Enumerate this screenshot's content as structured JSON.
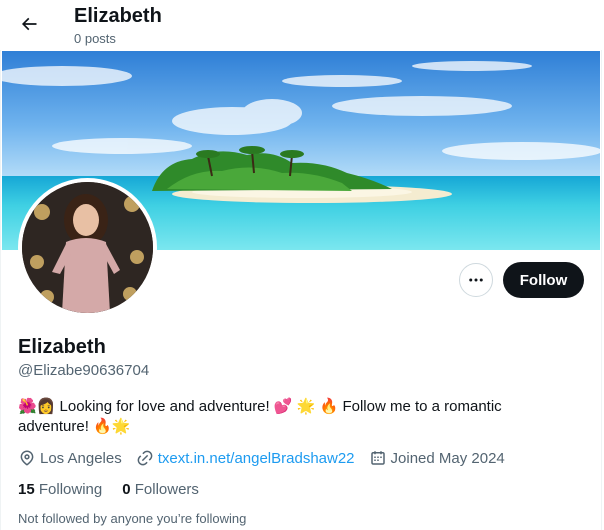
{
  "header": {
    "title": "Elizabeth",
    "post_count": "0 posts"
  },
  "profile": {
    "name": "Elizabeth",
    "handle": "@Elizabe90636704",
    "bio_text_1": "Looking for love and adventure!",
    "bio_text_2": "Follow me to a romantic adventure!",
    "location": "Los Angeles",
    "link": "txext.in.net/angelBradshaw22",
    "joined": "Joined May 2024",
    "following_count": "15",
    "following_label": "Following",
    "followers_count": "0",
    "followers_label": "Followers",
    "followed_by_note": "Not followed by anyone you’re following"
  },
  "actions": {
    "follow_label": "Follow"
  },
  "emojis": {
    "flower": "🌺",
    "girl": "👩",
    "hearts": "💕",
    "star": "🌟",
    "fire": "🔥"
  },
  "colors": {
    "accent": "#1d9bf0",
    "text": "#0f1419",
    "secondary": "#536471",
    "follow_bg": "#0f1419"
  }
}
